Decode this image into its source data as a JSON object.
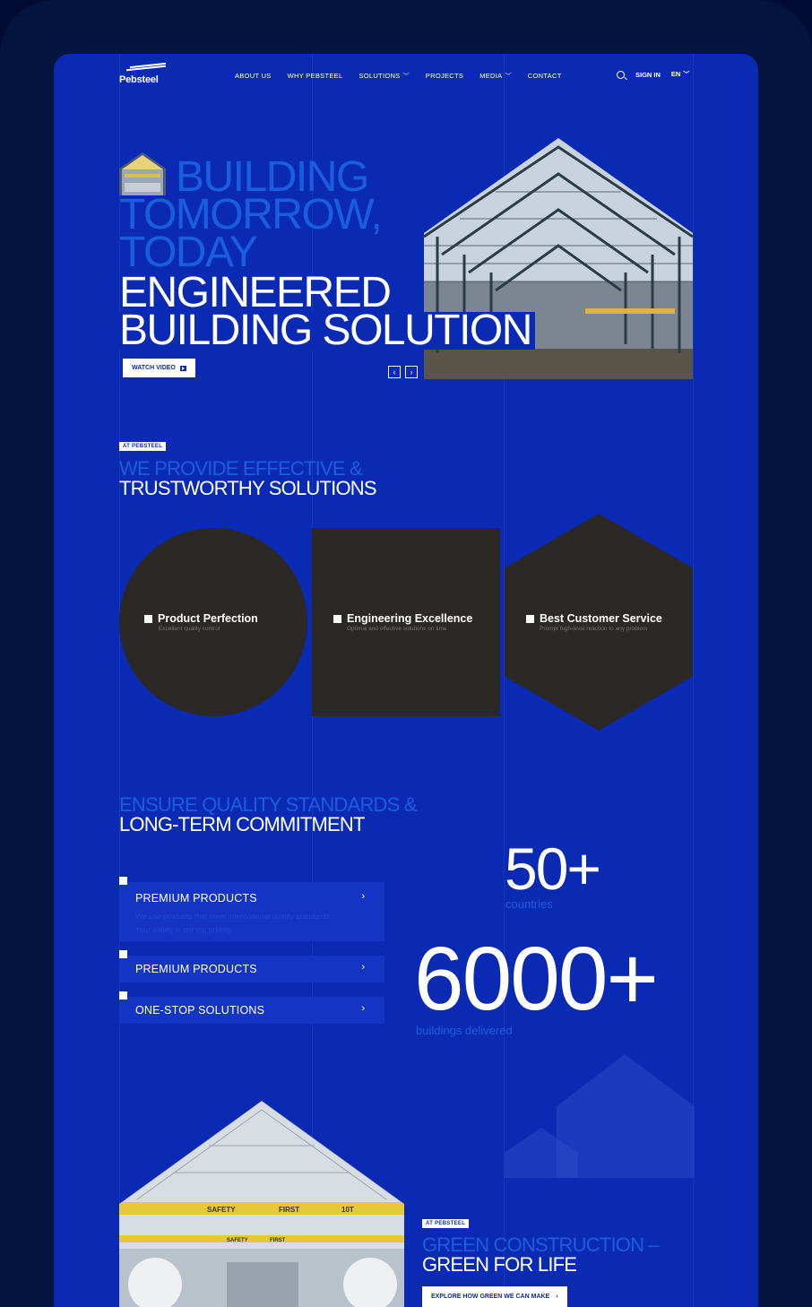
{
  "nav": {
    "logo": "Pebsteel",
    "items": [
      {
        "label": "ABOUT US",
        "dropdown": false
      },
      {
        "label": "WHY PEBSTEEL",
        "dropdown": false
      },
      {
        "label": "SOLUTIONS",
        "dropdown": true
      },
      {
        "label": "PROJECTS",
        "dropdown": false
      },
      {
        "label": "MEDIA",
        "dropdown": true
      },
      {
        "label": "CONTACT",
        "dropdown": false
      }
    ],
    "sign_in": "SIGN IN",
    "language": "EN"
  },
  "hero": {
    "headline_blue": [
      "BUILDING",
      "TOMORROW,",
      "TODAY"
    ],
    "headline_white": [
      "ENGINEERED",
      "BUILDING SOLUTION"
    ],
    "watch_label": "WATCH VIDEO",
    "prev": "‹",
    "next": "›"
  },
  "solutions": {
    "tag": "AT PEBSTEEL",
    "heading_blue": "WE PROVIDE EFFECTIVE &",
    "heading_white": "TRUSTWORTHY SOLUTIONS",
    "cards": [
      {
        "title": "Product Perfection",
        "sub": "Excellent quality control"
      },
      {
        "title": "Engineering Excellence",
        "sub": "Optimal and effective solutions on time"
      },
      {
        "title": "Best Customer Service",
        "sub": "Prompt high-level reaction to any problem"
      }
    ]
  },
  "quality": {
    "heading_blue": "ENSURE QUALITY STANDARDS &",
    "heading_white": "LONG-TERM COMMITMENT",
    "items": [
      {
        "label": "PREMIUM PRODUCTS",
        "desc": "We use products that meet international quality standards. Your safety is our top priority."
      },
      {
        "label": "PREMIUM PRODUCTS"
      },
      {
        "label": "ONE-STOP SOLUTIONS"
      }
    ],
    "stats": [
      {
        "value": "50+",
        "label": "countries"
      },
      {
        "value": "6000+",
        "label": "buildings delivered"
      }
    ]
  },
  "green": {
    "tag": "AT PEBSTEEL",
    "heading_blue": "GREEN CONSTRUCTION –",
    "heading_white": "GREEN FOR LIFE",
    "cta": "EXPLORE HOW GREEN WE CAN MAKE",
    "crane_text": [
      "SAFETY",
      "FIRST",
      "10T",
      "SAFETY",
      "FIRST"
    ]
  },
  "colors": {
    "background": "#0a2ab4",
    "accent_blue": "#1a5ee0",
    "card": "#2b2825",
    "frame": "#03143f"
  }
}
